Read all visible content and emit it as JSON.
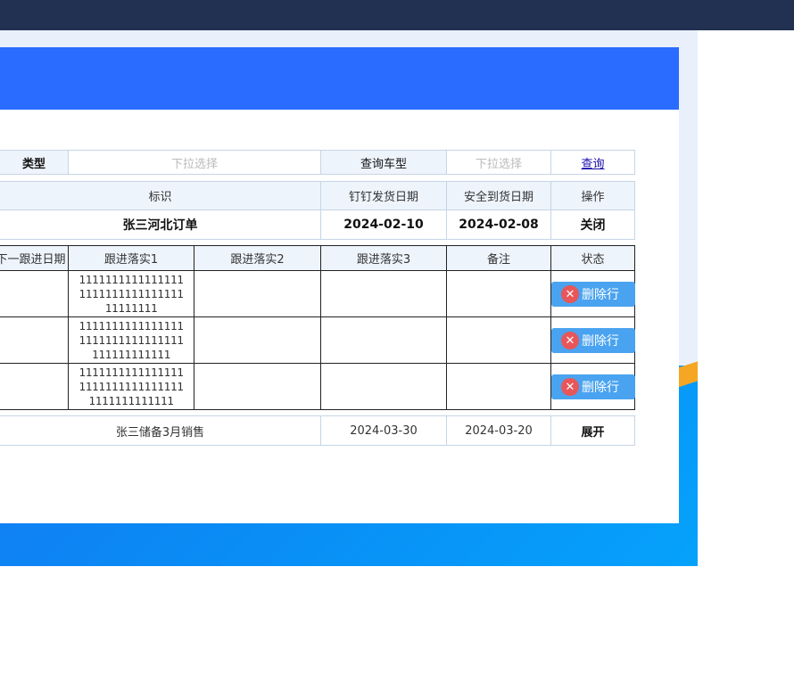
{
  "query_bar": {
    "type_label": "类型",
    "type_placeholder": "下拉选择",
    "car_type_label": "查询车型",
    "car_type_placeholder": "下拉选择",
    "query_link": "查询"
  },
  "order_table": {
    "headers": [
      "标识",
      "钉钉发货日期",
      "安全到货日期",
      "操作"
    ],
    "row": {
      "name": "张三河北订单",
      "ship_date": "2024-02-10",
      "arrive_date": "2024-02-08",
      "action": "关闭"
    }
  },
  "followup_table": {
    "headers": [
      "下一跟进日期",
      "跟进落实1",
      "跟进落实2",
      "跟进落实3",
      "备注",
      "状态"
    ],
    "rows": [
      {
        "f1": [
          "1111111111111111",
          "1111111111111111",
          "11111111"
        ]
      },
      {
        "f1": [
          "1111111111111111",
          "1111111111111111",
          "111111111111"
        ]
      },
      {
        "f1": [
          "1111111111111111",
          "1111111111111111",
          "1111111111111"
        ]
      }
    ],
    "delete_label": "删除行"
  },
  "second_order": {
    "name": "张三储备3月销售",
    "ship_date": "2024-03-30",
    "arrive_date": "2024-03-20",
    "action": "展开"
  }
}
